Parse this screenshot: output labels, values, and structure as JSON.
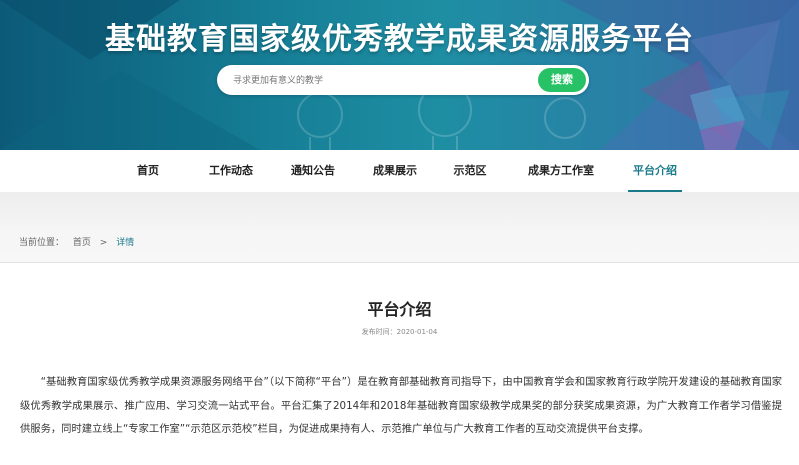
{
  "header": {
    "site_title": "基础教育国家级优秀教学成果资源服务平台",
    "search": {
      "placeholder": "寻求更加有意义的教学",
      "button_label": "搜索"
    }
  },
  "nav": {
    "items": [
      {
        "label": "首页"
      },
      {
        "label": "工作动态"
      },
      {
        "label": "通知公告"
      },
      {
        "label": "成果展示"
      },
      {
        "label": "示范区"
      },
      {
        "label": "成果方工作室"
      },
      {
        "label": "平台介绍"
      }
    ],
    "active_index": 6
  },
  "breadcrumb": {
    "prefix": "当前位置：",
    "home": "首页",
    "separator": ">",
    "current": "详情"
  },
  "article": {
    "title": "平台介绍",
    "meta": "发布时间：2020-01-04",
    "body": "“基础教育国家级优秀教学成果资源服务网络平台”（以下简称“平台”）是在教育部基础教育司指导下，由中国教育学会和国家教育行政学院开发建设的基础教育国家级优秀教学成果展示、推广应用、学习交流一站式平台。平台汇集了2014年和2018年基础教育国家级教学成果奖的部分获奖成果资源，为广大教育工作者学习借鉴提供服务，同时建立线上“专家工作室”“示范区示范校”栏目，为促进成果持有人、示范推广单位与广大教育工作者的互动交流提供平台支撑。"
  },
  "colors": {
    "banner": "#167f97",
    "accent": "#1b7a8a",
    "search_button": "#27c265"
  }
}
